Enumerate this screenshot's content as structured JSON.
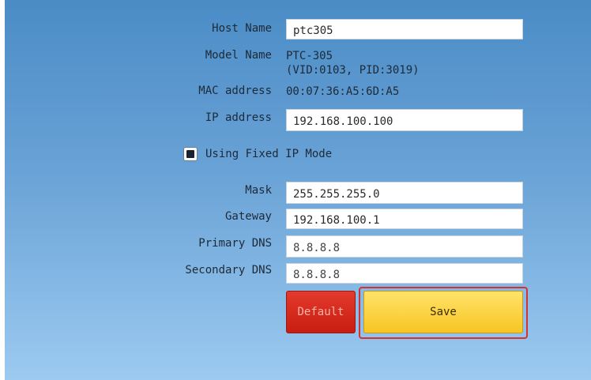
{
  "form": {
    "host_name": {
      "label": "Host Name",
      "value": "ptc305"
    },
    "model_name": {
      "label": "Model Name",
      "line1": "PTC-305",
      "line2": "(VID:0103, PID:3019)"
    },
    "mac_address": {
      "label": "MAC address",
      "value": "00:07:36:A5:6D:A5"
    },
    "ip_address": {
      "label": "IP address",
      "value": "192.168.100.100"
    },
    "fixed_ip": {
      "label": "Using Fixed IP Mode",
      "checked": true
    },
    "mask": {
      "label": "Mask",
      "value": "255.255.255.0"
    },
    "gateway": {
      "label": "Gateway",
      "value": "192.168.100.1"
    },
    "primary_dns": {
      "label": "Primary DNS",
      "value": "8.8.8.8"
    },
    "secondary_dns": {
      "label": "Secondary DNS",
      "value": "8.8.8.8"
    }
  },
  "buttons": {
    "default_label": "Default",
    "save_label": "Save"
  },
  "colors": {
    "panel_top": "#4b8cc6",
    "panel_bottom": "#9ccaf0",
    "default_button": "#d42a1e",
    "save_button": "#fbd444",
    "highlight_outline": "#d63232"
  },
  "icons": {
    "checkbox": "checkbox-checked-icon"
  }
}
